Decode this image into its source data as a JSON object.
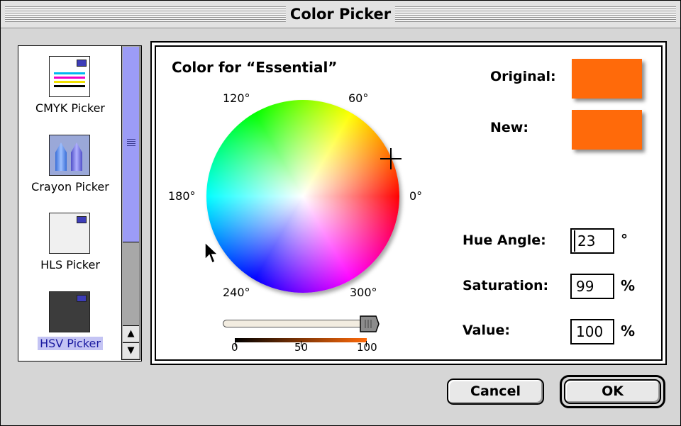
{
  "window": {
    "title": "Color Picker"
  },
  "pickers": [
    {
      "label": "CMYK Picker",
      "icon": "cmyk-picker-icon",
      "selected": false
    },
    {
      "label": "Crayon Picker",
      "icon": "crayon-picker-icon",
      "selected": false
    },
    {
      "label": "HLS Picker",
      "icon": "hls-picker-icon",
      "selected": false
    },
    {
      "label": "HSV Picker",
      "icon": "hsv-picker-icon",
      "selected": true
    }
  ],
  "panel": {
    "heading": "Color for “Essential”",
    "degree_labels": {
      "d0": "0°",
      "d60": "60°",
      "d120": "120°",
      "d180": "180°",
      "d240": "240°",
      "d300": "300°"
    },
    "value_scale": {
      "min": "0",
      "mid": "50",
      "max": "100"
    },
    "original_label": "Original:",
    "new_label": "New:",
    "original_color": "#ff6a0a",
    "new_color": "#ff6a0a",
    "hue": {
      "label": "Hue Angle:",
      "value": "23",
      "unit": "°"
    },
    "saturation": {
      "label": "Saturation:",
      "value": "99",
      "unit": "%"
    },
    "value": {
      "label": "Value:",
      "value": "100",
      "unit": "%"
    }
  },
  "buttons": {
    "cancel": "Cancel",
    "ok": "OK"
  }
}
